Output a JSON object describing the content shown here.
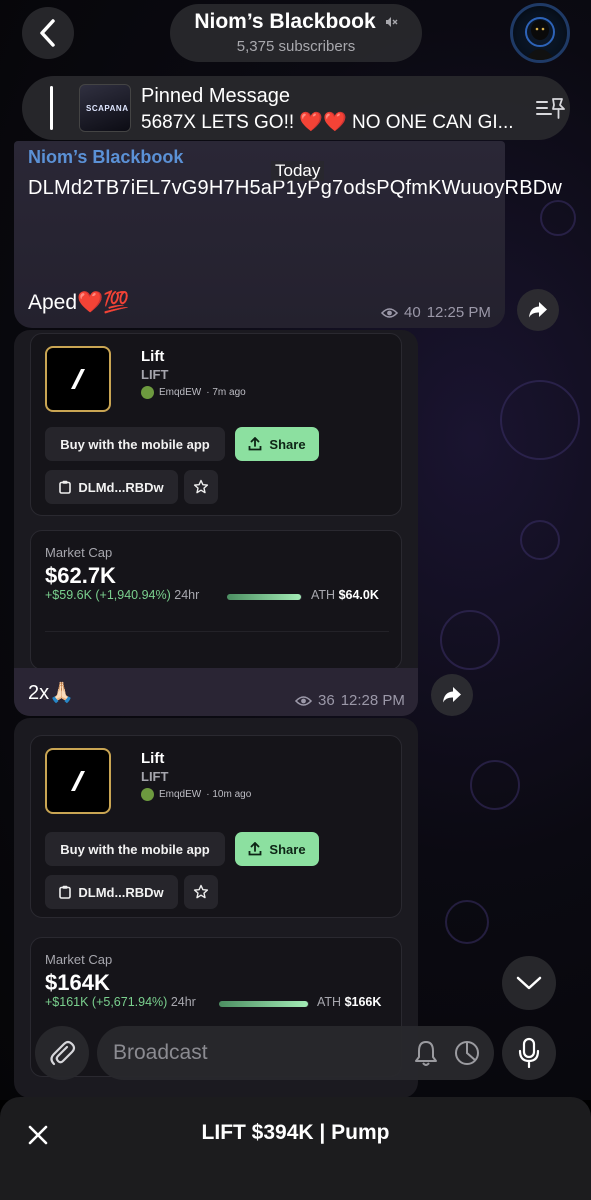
{
  "header": {
    "back_icon": "chevron-left-icon",
    "channel_title": "Niom’s Blackbook",
    "muted_icon": "speaker-muted-icon",
    "subscribers": "5,375 subscribers"
  },
  "pinned": {
    "thumbnail_text": "SCAPANA",
    "title": "Pinned Message",
    "text": "5687X LETS GO!! ❤️❤️ NO ONE CAN GI...",
    "icon": "pin-list-icon"
  },
  "date_separator": "Today",
  "message1": {
    "sender": "Niom’s Blackbook",
    "text": "DLMd2TB7iEL7vG9H7H5aP1yPg7odsPQfmKWuuoyRBDw",
    "caption": "Aped❤️💯",
    "views": "40",
    "time": "12:25 PM"
  },
  "message2": {
    "token": {
      "name": "Lift",
      "symbol": "LIFT",
      "creator": "EmqdEW",
      "age": "· 7m ago",
      "buy_label": "Buy with the mobile app",
      "share_label": "Share",
      "address_short": "DLMd...RBDw"
    },
    "market": {
      "label": "Market Cap",
      "value": "$62.7K",
      "change": "+$59.6K (+1,940.94%)",
      "period": "24hr",
      "ath_label": "ATH",
      "ath_value": "$64.0K",
      "ath_progress": 0.98
    },
    "caption": "2x🙏🏻",
    "views": "36",
    "time": "12:28 PM"
  },
  "message3": {
    "token": {
      "name": "Lift",
      "symbol": "LIFT",
      "creator": "EmqdEW",
      "age": "· 10m ago",
      "buy_label": "Buy with the mobile app",
      "share_label": "Share",
      "address_short": "DLMd...RBDw"
    },
    "market": {
      "label": "Market Cap",
      "value": "$164K",
      "change": "+$161K (+5,671.94%)",
      "period": "24hr",
      "ath_label": "ATH",
      "ath_value": "$166K",
      "ath_progress": 0.99
    }
  },
  "input": {
    "placeholder": "Broadcast"
  },
  "sheet": {
    "title": "LIFT $394K | Pump"
  },
  "colors": {
    "sender_blue": "#5b91d6",
    "green_button": "#8ce0a0",
    "positive_change": "#7ad08e",
    "logo_border_gold": "#c9a553"
  }
}
